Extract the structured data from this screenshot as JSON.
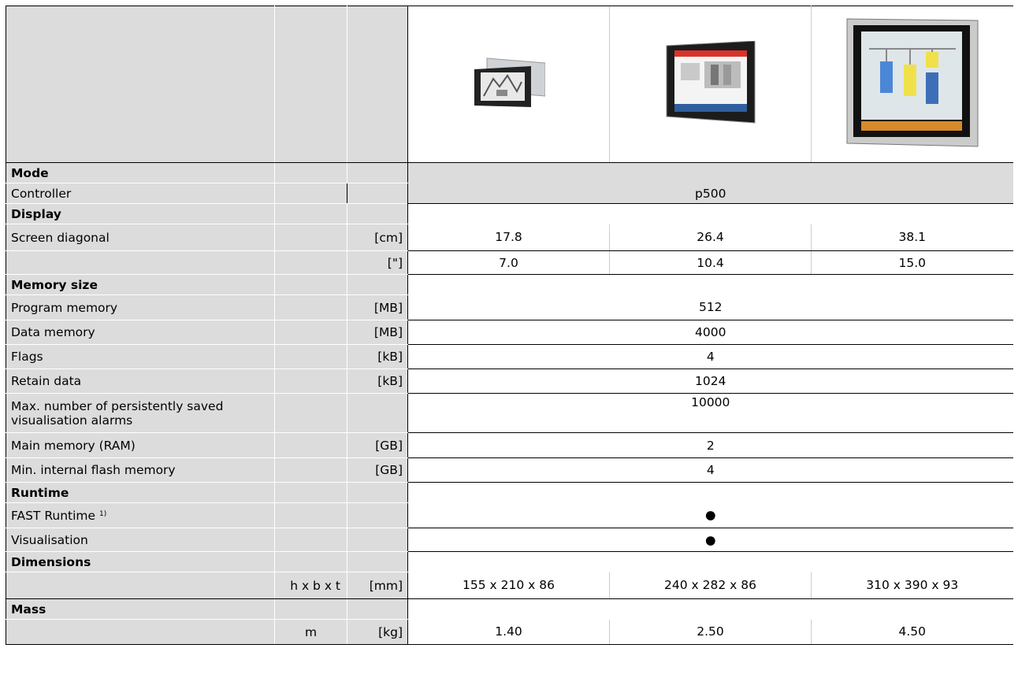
{
  "products": [
    {
      "image": "hmi-panel-7-icon",
      "screen_cm": "17.8",
      "screen_in": "7.0",
      "dims": "155 x 210 x 86",
      "mass": "1.40"
    },
    {
      "image": "hmi-panel-10-icon",
      "screen_cm": "26.4",
      "screen_in": "10.4",
      "dims": "240 x 282 x 86",
      "mass": "2.50"
    },
    {
      "image": "hmi-panel-15-icon",
      "screen_cm": "38.1",
      "screen_in": "15.0",
      "dims": "310 x 390 x 93",
      "mass": "4.50"
    }
  ],
  "sections": {
    "mode": "Mode",
    "display": "Display",
    "memory": "Memory size",
    "runtime": "Runtime",
    "dimensions": "Dimensions",
    "mass": "Mass"
  },
  "rows": {
    "controller": {
      "label": "Controller",
      "value": "p500"
    },
    "screen_diag": {
      "label": "Screen diagonal",
      "unit_cm": "[cm]",
      "unit_in": "[\"]"
    },
    "program_memory": {
      "label": "Program memory",
      "unit": "[MB]",
      "value": "512"
    },
    "data_memory": {
      "label": "Data memory",
      "unit": "[MB]",
      "value": "4000"
    },
    "flags": {
      "label": "Flags",
      "unit": "[kB]",
      "value": "4"
    },
    "retain": {
      "label": "Retain data",
      "unit": "[kB]",
      "value": "1024"
    },
    "alarms": {
      "label": "Max. number of persistently saved visualisation alarms",
      "value": "10000"
    },
    "ram": {
      "label": "Main memory (RAM)",
      "unit": "[GB]",
      "value": "2"
    },
    "flash": {
      "label": "Min. internal flash memory",
      "unit": "[GB]",
      "value": "4"
    },
    "fast_runtime": {
      "label": "FAST Runtime",
      "footnote": "1)",
      "value": "●"
    },
    "visualisation": {
      "label": "Visualisation",
      "value": "●"
    },
    "dims": {
      "symbol": "h x b x t",
      "unit": "[mm]"
    },
    "mass": {
      "symbol": "m",
      "unit": "[kg]"
    }
  }
}
